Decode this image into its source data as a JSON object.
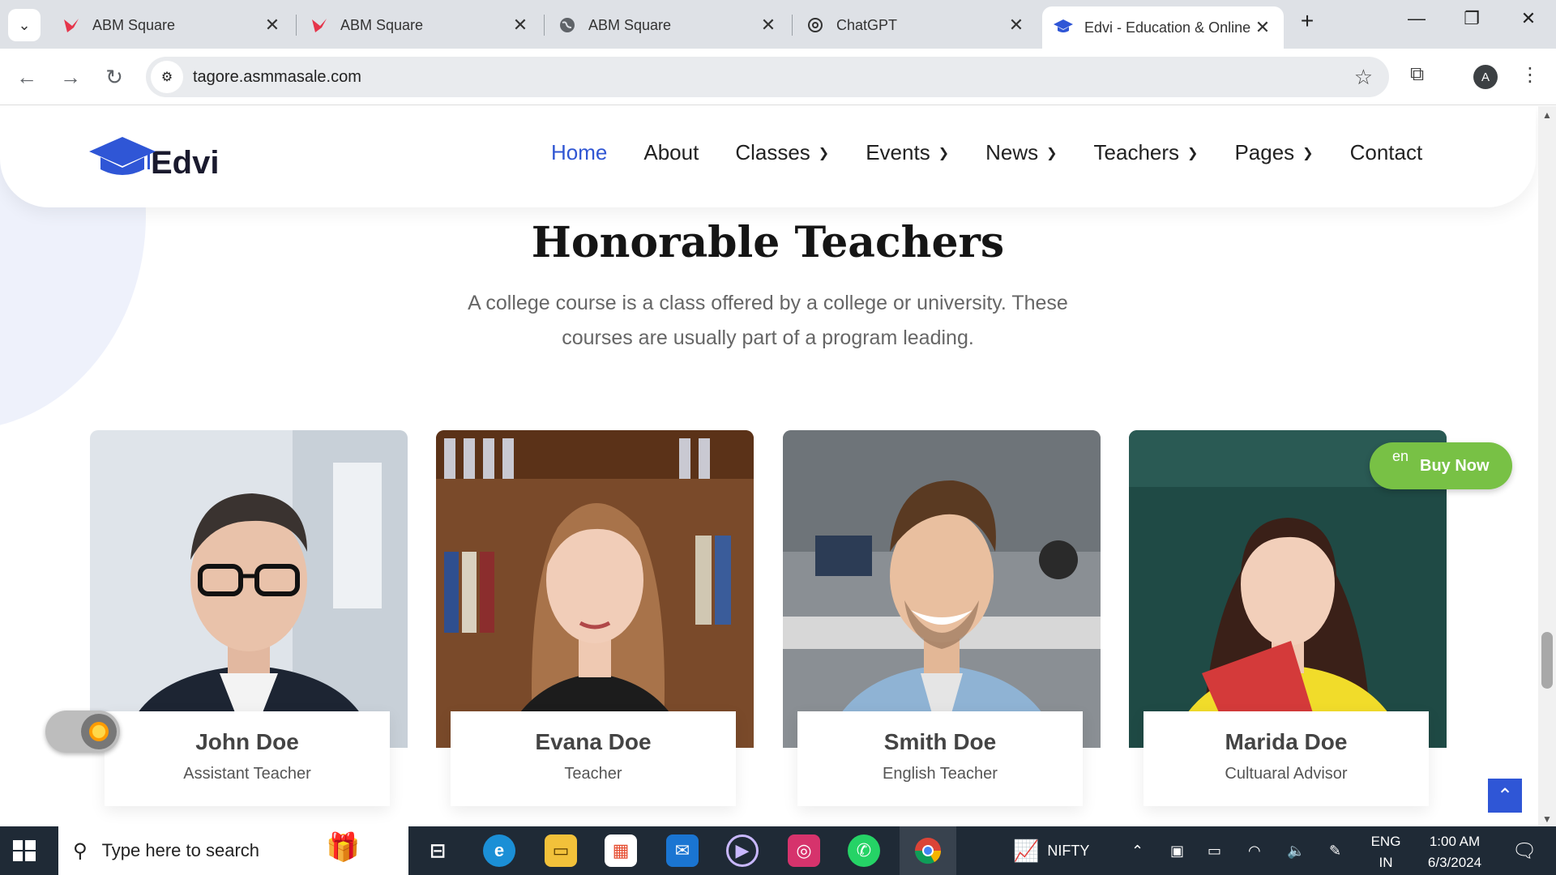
{
  "browser": {
    "tabs": [
      {
        "title": "ABM Square",
        "favicon": "abm-bird-icon"
      },
      {
        "title": "ABM Square",
        "favicon": "abm-bird-icon"
      },
      {
        "title": "ABM Square",
        "favicon": "globe-icon"
      },
      {
        "title": "ChatGPT",
        "favicon": "chatgpt-icon"
      },
      {
        "title": "Edvi - Education & Online",
        "favicon": "graduation-cap-icon",
        "active": true
      }
    ],
    "url": "tagore.asmmasale.com",
    "profile_initial": "A"
  },
  "site": {
    "logo_text": "Edvi",
    "nav": [
      {
        "label": "Home",
        "active": true,
        "dropdown": false
      },
      {
        "label": "About",
        "active": false,
        "dropdown": false
      },
      {
        "label": "Classes",
        "active": false,
        "dropdown": true
      },
      {
        "label": "Events",
        "active": false,
        "dropdown": true
      },
      {
        "label": "News",
        "active": false,
        "dropdown": true
      },
      {
        "label": "Teachers",
        "active": false,
        "dropdown": true
      },
      {
        "label": "Pages",
        "active": false,
        "dropdown": true
      },
      {
        "label": "Contact",
        "active": false,
        "dropdown": false
      }
    ],
    "section": {
      "title": "Honorable Teachers",
      "description": "A college course is a class offered by a college or university. These courses are usually part of a program leading."
    },
    "teachers": [
      {
        "name": "John Doe",
        "role": "Assistant Teacher"
      },
      {
        "name": "Evana Doe",
        "role": "Teacher"
      },
      {
        "name": "Smith Doe",
        "role": "English Teacher"
      },
      {
        "name": "Marida Doe",
        "role": "Cultuaral Advisor"
      }
    ],
    "buy_now": {
      "label": "Buy Now",
      "broken_img_alt": "en"
    },
    "accent_color": "#3056d3"
  },
  "taskbar": {
    "search_placeholder": "Type here to search",
    "ticker": "NIFTY",
    "lang": [
      "ENG",
      "IN"
    ],
    "time": "1:00 AM",
    "date": "6/3/2024"
  }
}
